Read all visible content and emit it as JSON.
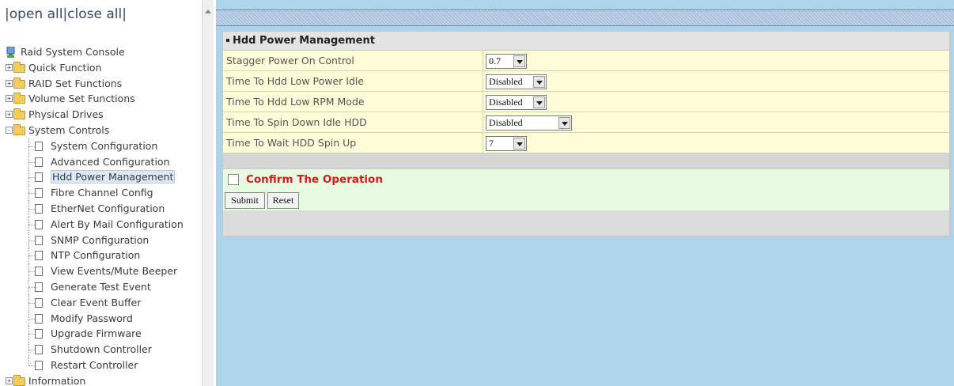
{
  "nav": {
    "open_all": "open all",
    "close_all": "close all",
    "sep_left": "|",
    "sep_mid": "|",
    "sep_right": "|",
    "root": "Raid System Console",
    "groups": [
      {
        "label": "Quick Function",
        "expander": "+"
      },
      {
        "label": "RAID Set Functions",
        "expander": "+"
      },
      {
        "label": "Volume Set Functions",
        "expander": "+"
      },
      {
        "label": "Physical Drives",
        "expander": "+"
      },
      {
        "label": "System Controls",
        "expander": "-"
      }
    ],
    "system_controls_items": [
      "System Configuration",
      "Advanced Configuration",
      "Hdd Power Management",
      "Fibre Channel Config",
      "EtherNet Configuration",
      "Alert By Mail Configuration",
      "SNMP Configuration",
      "NTP Configuration",
      "View Events/Mute Beeper",
      "Generate Test Event",
      "Clear Event Buffer",
      "Modify Password",
      "Upgrade Firmware",
      "Shutdown Controller",
      "Restart Controller"
    ],
    "selected_item": "Hdd Power Management",
    "information": {
      "label": "Information",
      "expander": "+"
    }
  },
  "panel": {
    "title": "Hdd Power Management",
    "fields": [
      {
        "label": "Stagger Power On Control",
        "value": "0.7"
      },
      {
        "label": "Time To Hdd Low Power Idle",
        "value": "Disabled"
      },
      {
        "label": "Time To Hdd Low RPM Mode",
        "value": "Disabled"
      },
      {
        "label": "Time To Spin Down Idle HDD",
        "value": "Disabled"
      },
      {
        "label": "Time To Wait HDD Spin Up",
        "value": "7"
      }
    ],
    "confirm_label": "Confirm The Operation",
    "confirm_checked": false,
    "submit_label": "Submit",
    "reset_label": "Reset"
  },
  "colors": {
    "main_background": "#add4ea",
    "field_row": "#fffdd8",
    "confirm_row": "#e7fbe3",
    "confirm_text": "#d51a1a"
  }
}
